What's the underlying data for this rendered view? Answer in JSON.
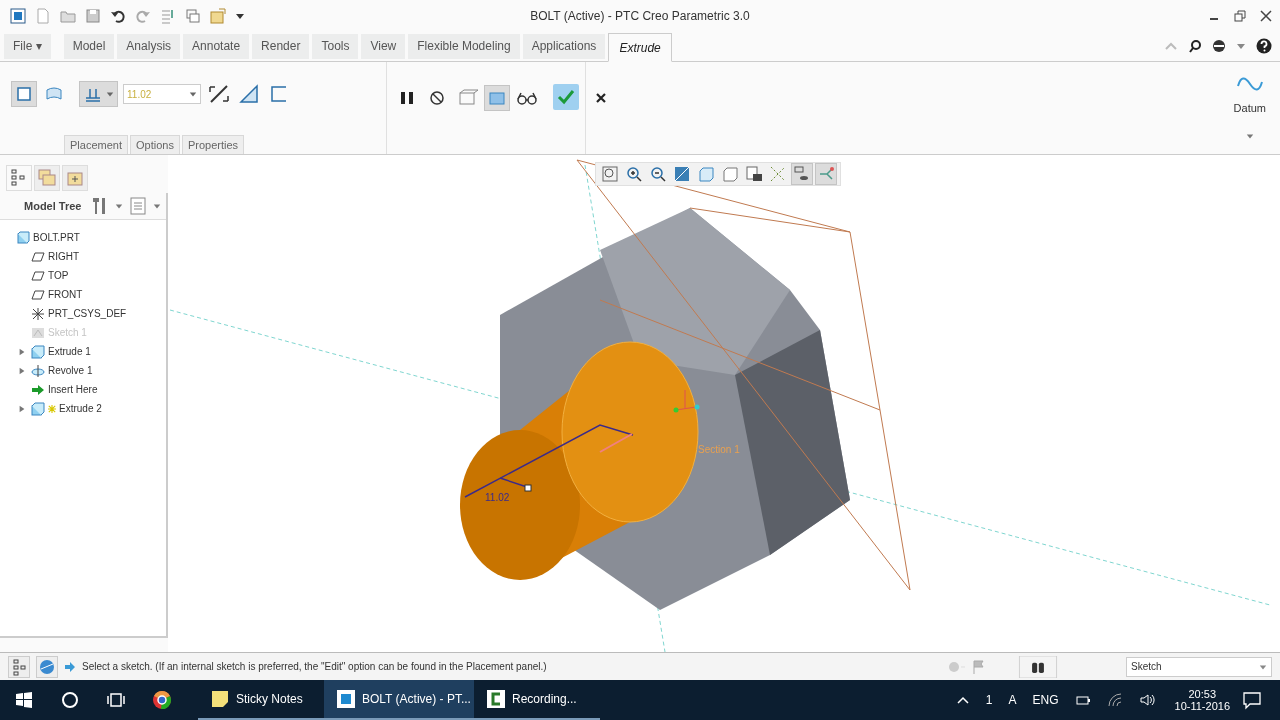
{
  "window": {
    "title": "BOLT (Active) - PTC Creo Parametric 3.0"
  },
  "ribbon_tabs": [
    {
      "label": "File ▾",
      "selected": false
    },
    {
      "label": "Model",
      "selected": false
    },
    {
      "label": "Analysis",
      "selected": false
    },
    {
      "label": "Annotate",
      "selected": false
    },
    {
      "label": "Render",
      "selected": false
    },
    {
      "label": "Tools",
      "selected": false
    },
    {
      "label": "View",
      "selected": false
    },
    {
      "label": "Flexible Modeling",
      "selected": false
    },
    {
      "label": "Applications",
      "selected": false
    },
    {
      "label": "Extrude",
      "selected": true
    }
  ],
  "depth_field": {
    "value": "11.02"
  },
  "dashboard_tabs": [
    {
      "label": "Placement",
      "selected": false
    },
    {
      "label": "Options",
      "selected": false
    },
    {
      "label": "Properties",
      "selected": false
    }
  ],
  "datum": {
    "label": "Datum"
  },
  "model_tree": {
    "title": "Model Tree",
    "root": {
      "label": "BOLT.PRT",
      "children": [
        {
          "label": "RIGHT",
          "kind": "plane",
          "expandable": false,
          "disabled": false
        },
        {
          "label": "TOP",
          "kind": "plane",
          "expandable": false,
          "disabled": false
        },
        {
          "label": "FRONT",
          "kind": "plane",
          "expandable": false,
          "disabled": false
        },
        {
          "label": "PRT_CSYS_DEF",
          "kind": "csys",
          "expandable": false,
          "disabled": false
        },
        {
          "label": "Sketch 1",
          "kind": "sketch",
          "expandable": false,
          "disabled": true
        },
        {
          "label": "Extrude 1",
          "kind": "extrude",
          "expandable": true,
          "disabled": false
        },
        {
          "label": "Revolve 1",
          "kind": "revolve",
          "expandable": true,
          "disabled": false
        },
        {
          "label": "Insert Here",
          "kind": "insert",
          "expandable": false,
          "disabled": false
        },
        {
          "label": "Extrude 2",
          "kind": "extrude_new",
          "expandable": true,
          "disabled": false
        }
      ]
    }
  },
  "canvas": {
    "dimension": "11.02",
    "section_label": "Section 1"
  },
  "status_bar": {
    "message": "Select a sketch. (If an internal sketch is preferred, the \"Edit\" option can be found in the Placement panel.)",
    "filter": "Sketch"
  },
  "taskbar": {
    "items": [
      {
        "label": "Sticky Notes",
        "kind": "notes",
        "selected": false
      },
      {
        "label": "BOLT (Active) - PT...",
        "kind": "creo",
        "selected": true
      },
      {
        "label": "Recording...",
        "kind": "recorder",
        "selected": false
      }
    ],
    "tray": [
      "1",
      "A",
      "ENG"
    ],
    "time": "20:53",
    "date": "10-11-2016"
  }
}
